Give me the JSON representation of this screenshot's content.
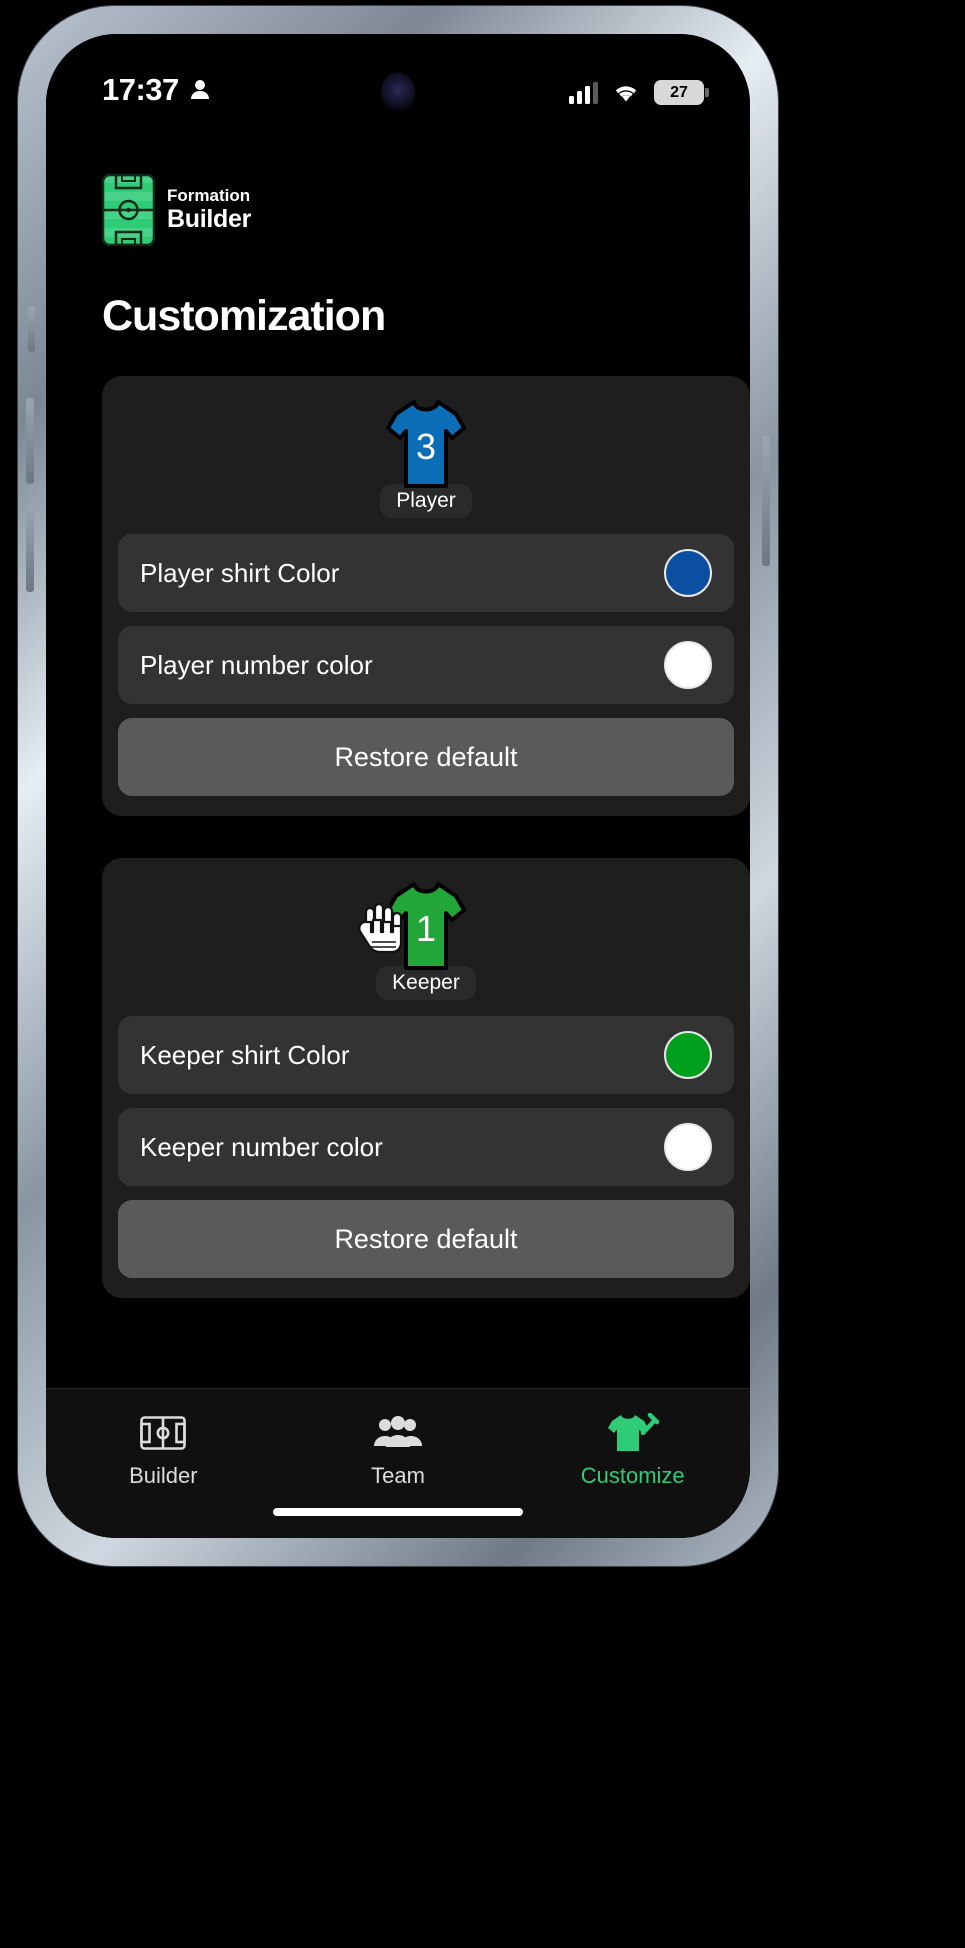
{
  "status_bar": {
    "time": "17:37",
    "person_icon": "person-icon",
    "signal_icon": "cellular-signal-icon",
    "wifi_icon": "wifi-icon",
    "battery_level": "27"
  },
  "app_header": {
    "logo_icon": "pitch-logo-icon",
    "line1": "Formation",
    "line2": "Builder"
  },
  "page_title": "Customization",
  "player_card": {
    "kit_number": "3",
    "kit_label": "Player",
    "shirt_color": "#0B6DB5",
    "number_color": "#FFFFFF",
    "rows": [
      {
        "label": "Player shirt Color",
        "color": "#0B4FA0"
      },
      {
        "label": "Player number color",
        "color": "#FFFFFF"
      }
    ],
    "restore_label": "Restore default"
  },
  "keeper_card": {
    "kit_number": "1",
    "kit_label": "Keeper",
    "shirt_color": "#23A638",
    "number_color": "#FFFFFF",
    "glove_icon": "goalkeeper-glove-icon",
    "rows": [
      {
        "label": "Keeper shirt Color",
        "color": "#00A01E"
      },
      {
        "label": "Keeper number color",
        "color": "#FFFFFF"
      }
    ],
    "restore_label": "Restore default"
  },
  "tabbar": {
    "active_color": "#2ecc77",
    "items": [
      {
        "label": "Builder",
        "icon": "pitch-icon",
        "active": false
      },
      {
        "label": "Team",
        "icon": "people-icon",
        "active": false
      },
      {
        "label": "Customize",
        "icon": "shirt-pencil-icon",
        "active": true
      }
    ]
  }
}
